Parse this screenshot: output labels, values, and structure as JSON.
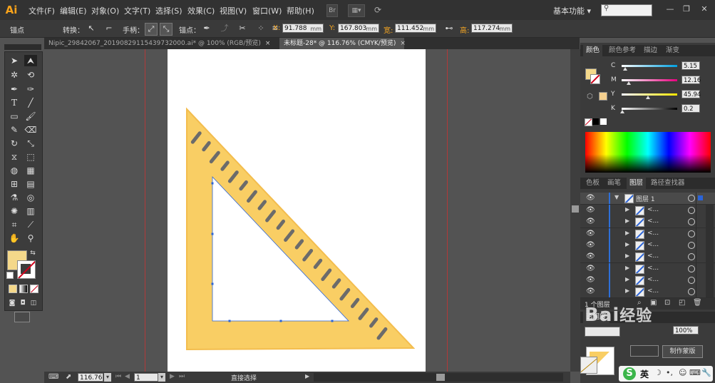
{
  "app": {
    "logo": "Ai"
  },
  "menu": [
    "文件(F)",
    "编辑(E)",
    "对象(O)",
    "文字(T)",
    "选择(S)",
    "效果(C)",
    "视图(V)",
    "窗口(W)",
    "帮助(H)"
  ],
  "menubar": {
    "bridge_label": "Br",
    "workspace": "基本功能",
    "search_icon": "search-icon"
  },
  "control": {
    "selection_label": "锚点",
    "convert_label": "转换：",
    "handle_label": "手柄：",
    "anchor_label": "锚点：",
    "x_label": "X:",
    "x_value": "91.788",
    "x_unit": "mm",
    "y_label": "Y:",
    "y_value": "167.803",
    "y_unit": "mm",
    "w_label": "宽:",
    "w_value": "111.452",
    "w_unit": "mm",
    "h_label": "高:",
    "h_value": "117.274",
    "h_unit": "mm"
  },
  "tabs": [
    {
      "label": "Nipic_29842067_20190829115439732000.ai* @ 100% (RGB/预览)",
      "close": "×"
    },
    {
      "label": "未标题-28* @ 116.76% (CMYK/预览)",
      "close": "×"
    }
  ],
  "color_panel": {
    "tabs": [
      "颜色",
      "颜色参考",
      "描边",
      "渐变"
    ],
    "channels": [
      {
        "label": "C",
        "value": "5.15",
        "pct": 0.05
      },
      {
        "label": "M",
        "value": "12.16",
        "pct": 0.12
      },
      {
        "label": "Y",
        "value": "45.94",
        "pct": 0.46
      },
      {
        "label": "K",
        "value": "0.2",
        "pct": 0.0
      }
    ],
    "fill_color": "#f4d88a"
  },
  "layers_panel": {
    "tabs": [
      "色板",
      "画笔",
      "图层",
      "路径查找器"
    ],
    "top_layer": "图层 1",
    "sublayer_label": "<...",
    "sublayer_count": 8,
    "footer_count": "1 个图层"
  },
  "transparency_panel": {
    "tab": "透明度",
    "opacity": "100%",
    "mask_button": "制作蒙版"
  },
  "status": {
    "zoom": "116.76",
    "page": "1",
    "tool": "直接选择"
  },
  "ime": {
    "label": "英"
  },
  "watermark": "Baidu经验",
  "colors": {
    "ruler": "#f9ce64",
    "ruler_edge": "#f3bd4e",
    "ticks": "#6b6b6b",
    "guide": "#b13a3a",
    "path": "#2b64d8"
  }
}
